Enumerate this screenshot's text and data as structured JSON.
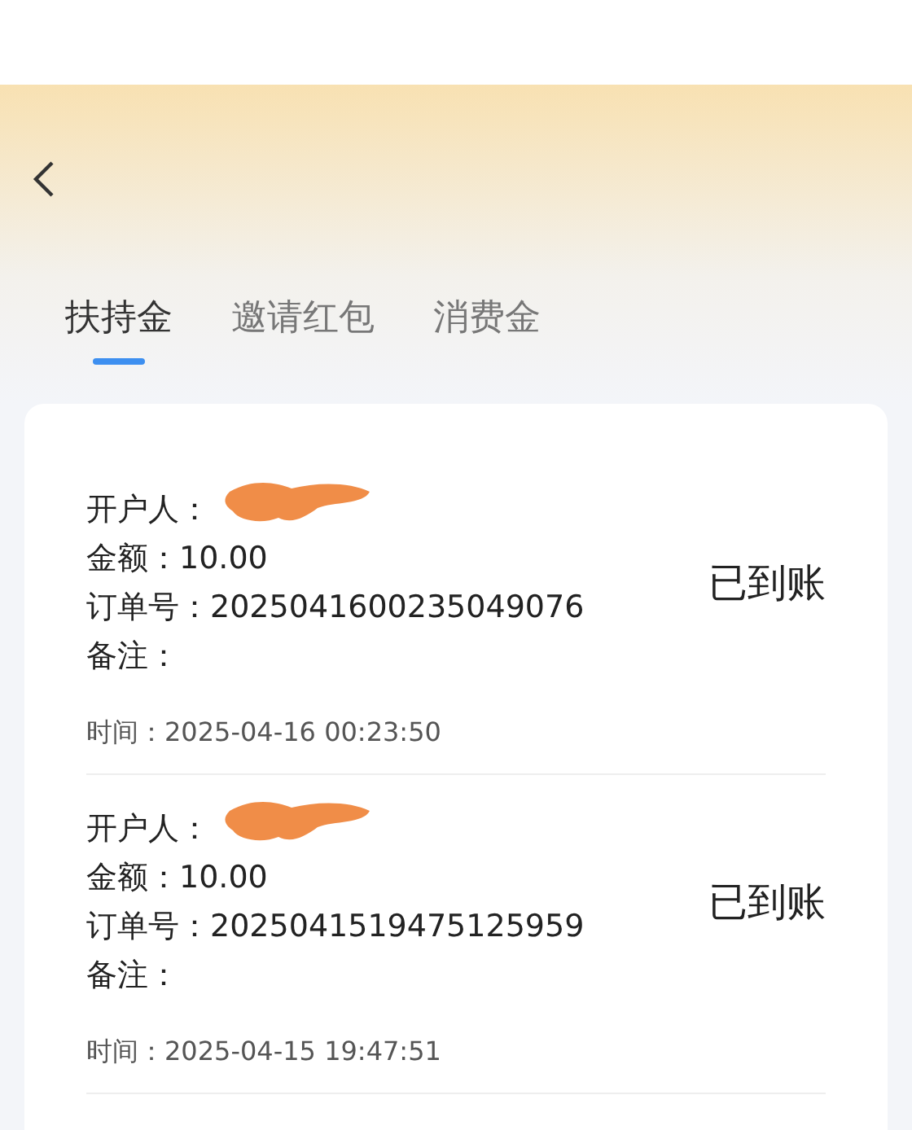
{
  "tabs": [
    {
      "label": "扶持金",
      "selected": true
    },
    {
      "label": "邀请红包",
      "selected": false
    },
    {
      "label": "消费金",
      "selected": false
    }
  ],
  "records": [
    {
      "lines": [
        {
          "label": "开户人："
        },
        {
          "label": "金额：",
          "value": "10.00"
        },
        {
          "label": "订单号：",
          "value": "2025041600235049076"
        },
        {
          "label": "备注："
        }
      ],
      "status": "已到账",
      "time": "时间：2025-04-16 00:23:50"
    },
    {
      "lines": [
        {
          "label": "开户人："
        },
        {
          "label": "金额：",
          "value": "10.00"
        },
        {
          "label": "订单号：",
          "value": "2025041519475125959"
        },
        {
          "label": "备注："
        }
      ],
      "status": "已到账",
      "time": "时间：2025-04-15 19:47:51"
    }
  ]
}
